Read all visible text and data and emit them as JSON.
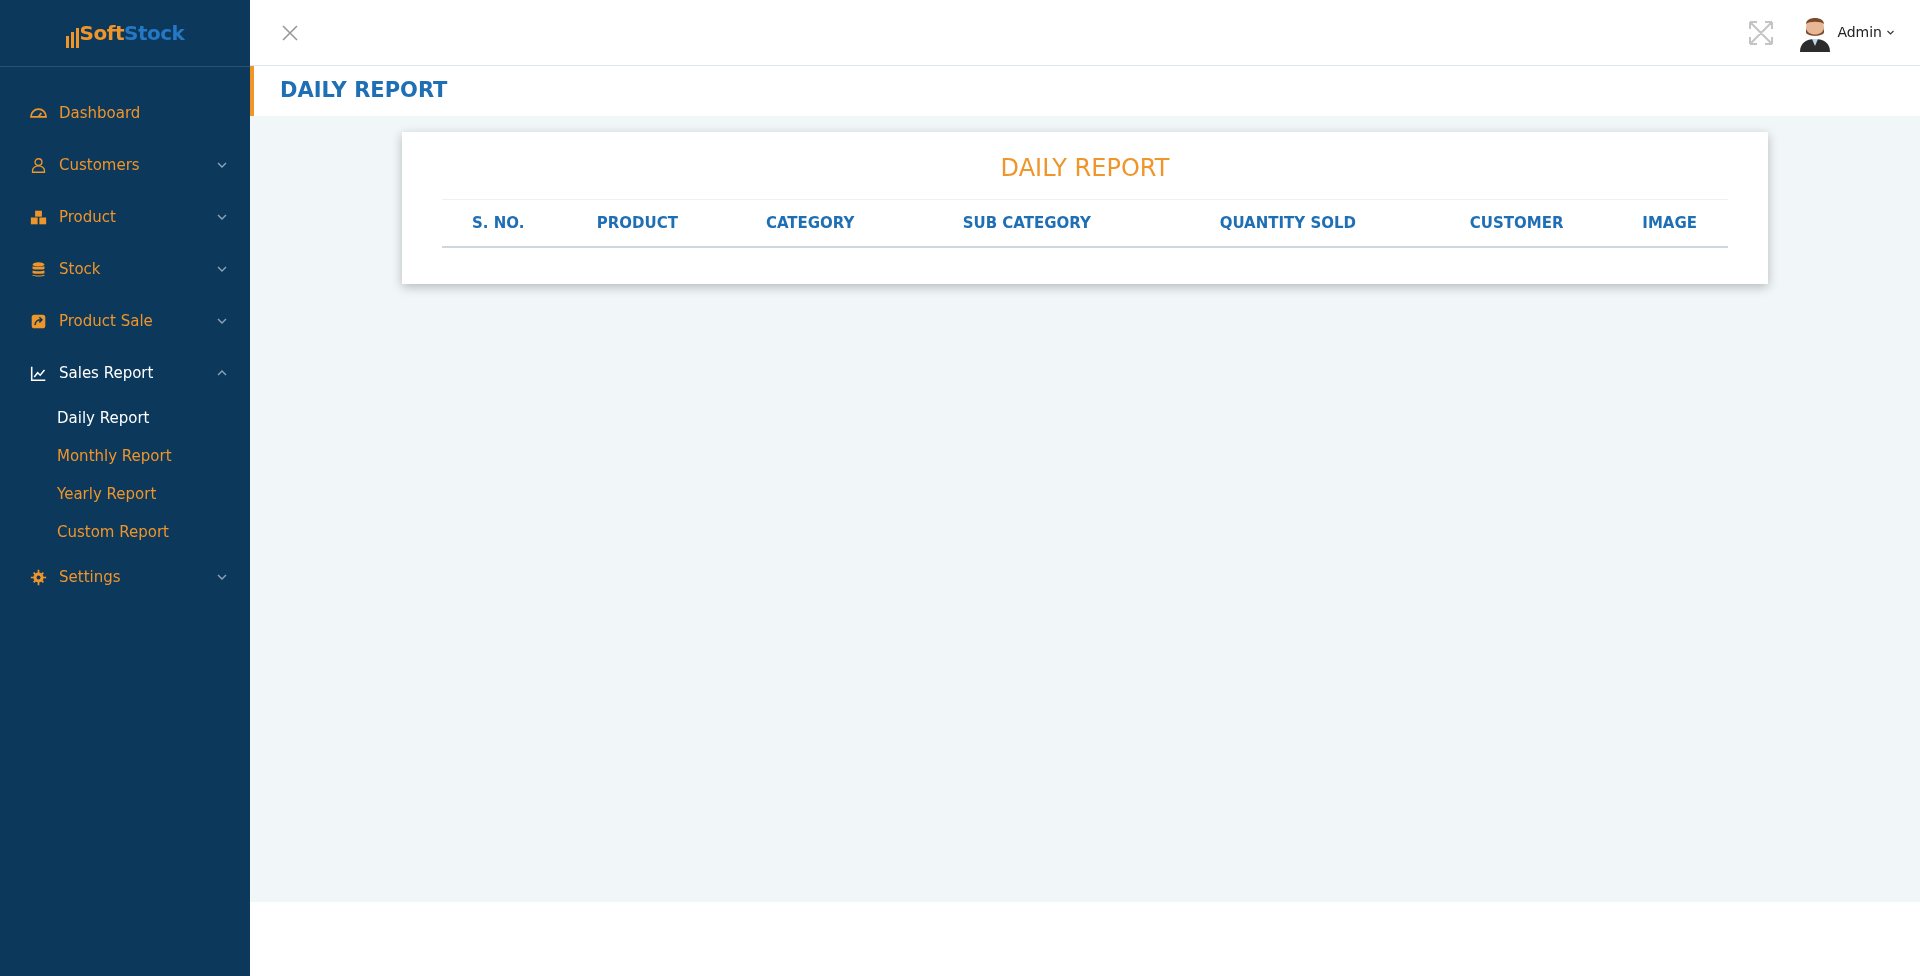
{
  "brand": {
    "part_1": "S",
    "part_2": "oft",
    "part_3": "Stock"
  },
  "sidebar": {
    "items": [
      {
        "kind": "dashboard",
        "label": "Dashboard",
        "selected": false
      },
      {
        "kind": "user",
        "label": "Customers",
        "expanded": false,
        "selected": false
      },
      {
        "kind": "boxes",
        "label": "Product",
        "expanded": false,
        "selected": false
      },
      {
        "kind": "database",
        "label": "Stock",
        "expanded": false,
        "selected": false
      },
      {
        "kind": "share",
        "label": "Product Sale",
        "expanded": false,
        "selected": false
      },
      {
        "kind": "chart",
        "label": "Sales Report",
        "expanded": true,
        "selected": true,
        "children": [
          {
            "label": "Daily Report",
            "selected": true
          },
          {
            "label": "Monthly Report",
            "selected": false
          },
          {
            "label": "Yearly Report",
            "selected": false
          },
          {
            "label": "Custom Report",
            "selected": false
          }
        ]
      },
      {
        "kind": "gear",
        "label": "Settings",
        "expanded": false,
        "selected": false
      }
    ]
  },
  "topbar": {
    "user": "Admin"
  },
  "page_title": "DAILY REPORT",
  "card": {
    "title": "DAILY REPORT",
    "table": {
      "columns": [
        "S. NO.",
        "PRODUCT",
        "CATEGORY",
        "SUB CATEGORY",
        "QUANTITY SOLD",
        "CUSTOMER",
        "IMAGE"
      ]
    }
  }
}
